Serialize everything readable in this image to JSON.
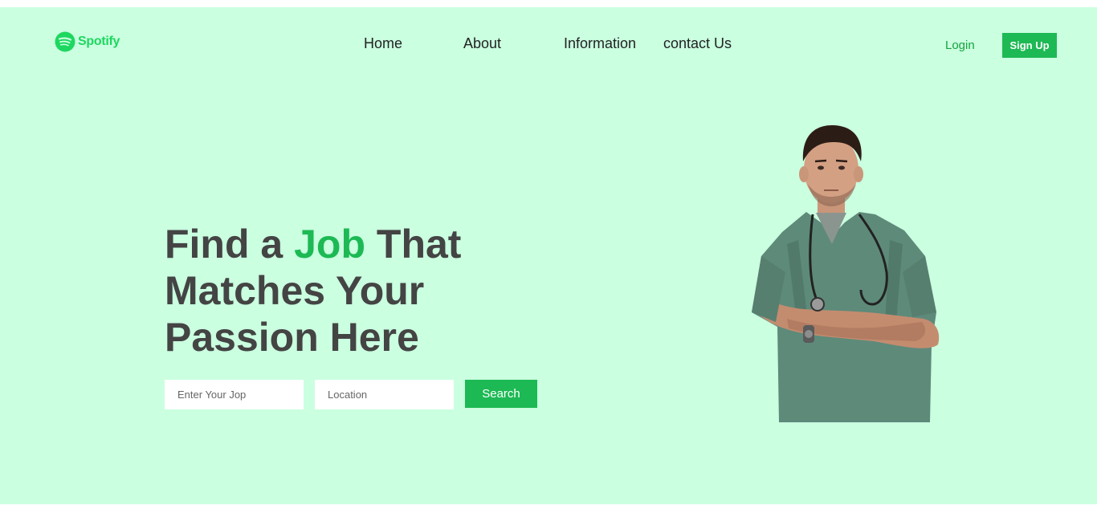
{
  "header": {
    "logo": {
      "text": "Spotify",
      "icon": "spotify-icon",
      "color": "#1ed760"
    },
    "nav": [
      {
        "label": "Home"
      },
      {
        "label": "About"
      },
      {
        "label": "Information"
      },
      {
        "label": "contact Us"
      }
    ],
    "login_label": "Login",
    "signup_label": "Sign Up"
  },
  "hero": {
    "title_part1": "Find a ",
    "title_accent": "Job",
    "title_part2": " That Matches Your Passion Here",
    "job_placeholder": "Enter Your Jop",
    "location_placeholder": "Location",
    "search_label": "Search",
    "image_icon": "doctor-illustration"
  },
  "colors": {
    "background": "#caffe0",
    "accent": "#1db954",
    "heading": "#444444",
    "login": "#17a33d"
  }
}
